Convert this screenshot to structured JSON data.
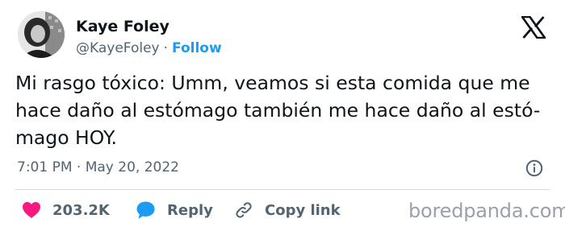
{
  "tweet": {
    "author": {
      "name": "Kaye Foley",
      "handle": "@KayeFoley",
      "separator": "·",
      "follow_label": "Follow"
    },
    "text_lines": [
      "Mi rasgo tóxico: Umm, veamos si esta comida que me",
      "hace daño al estómago también me hace daño al estó-",
      "mago HOY."
    ],
    "timestamp": "7:01 PM · May 20, 2022",
    "actions": {
      "like_count": "203.2K",
      "reply_label": "Reply",
      "copy_link_label": "Copy link"
    }
  },
  "watermark": "boredpanda.com",
  "colors": {
    "text": "#0f1419",
    "secondary": "#536471",
    "accent_blue": "#1d9bf0",
    "like_pink": "#f91880",
    "reply_blue": "#1d9bf0",
    "divider": "#cfd9de"
  },
  "icons": [
    "x-logo-icon",
    "info-icon",
    "heart-icon",
    "reply-bubble-icon",
    "link-icon"
  ]
}
